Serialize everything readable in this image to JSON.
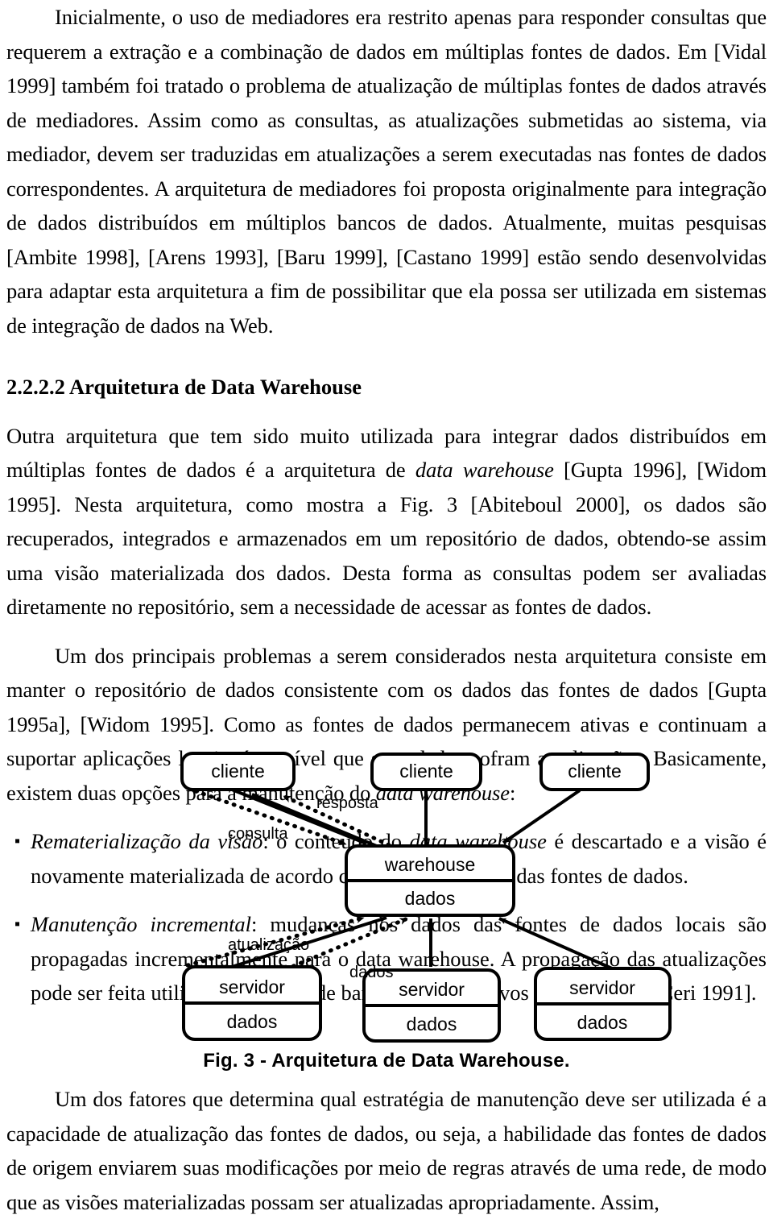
{
  "document": {
    "paragraphs": [
      {
        "id": "p1",
        "indent": true,
        "text": "Inicialmente, o uso de mediadores era restrito apenas para responder consultas que requerem a extração e a combinação de dados em múltiplas fontes de dados. Em [Vidal 1999] também foi tratado o problema de atualização de múltiplas fontes de dados através de mediadores. Assim como as consultas, as atualizações submetidas ao sistema, via mediador, devem ser traduzidas em atualizações a serem executadas nas fontes de dados correspondentes. A arquitetura de mediadores foi proposta originalmente para integração de dados distribuídos em múltiplos bancos de dados. Atualmente, muitas pesquisas [Ambite 1998], [Arens 1993], [Baru 1999], [Castano 1999] estão sendo desenvolvidas para adaptar esta arquitetura a fim de possibilitar que ela possa ser utilizada em sistemas de integração de dados na Web."
      }
    ],
    "heading": "2.2.2.2 Arquitetura de Data Warehouse",
    "paragraph2_parts": {
      "a": "Outra arquitetura que tem sido muito utilizada para integrar dados distribuídos em múltiplas fontes de dados é a arquitetura de ",
      "b_italic": "data warehouse",
      "c": " [Gupta 1996], [Widom 1995]. Nesta arquitetura, como mostra a Fig. 3 [Abiteboul 2000], os dados são recuperados, integrados e armazenados em um repositório de dados, obtendo-se assim uma visão materializada dos dados. Desta forma as consultas podem ser avaliadas diretamente no repositório, sem a necessidade de acessar as fontes de dados."
    },
    "paragraph3_parts": {
      "a": "Um dos principais problemas a serem considerados nesta arquitetura consiste em manter o repositório de dados consistente com os dados das fontes de dados [Gupta 1995a], [Widom 1995]. Como as fontes de dados permanecem ativas e continuam a suportar aplicações locais, é possível que seus dados sofram atualizações. Basicamente, existem duas opções para a manutenção do ",
      "b_italic": "data warehouse",
      "c": ":"
    },
    "bullets": [
      {
        "marker": "▪",
        "title_italic": "Rematerialização da visão",
        "mid": ": o conteúdo do ",
        "term_italic": "data warehouse",
        "rest": " é descartado e a visão é novamente materializada de acordo com os novos dados das fontes de dados."
      },
      {
        "marker": "▪",
        "title_italic": "Manutenção incremental",
        "mid": ": mudanças nos dados das fontes de dados locais são propagadas incrementalmente para o data warehouse. A propagação das atualizações pode ser feita utilizando técnicas de banco de dados ativos [Zhou 1996], [Ceri 1991].",
        "term_italic": "",
        "rest": ""
      }
    ],
    "paragraph4": "Um dos fatores que determina qual estratégia de manutenção deve ser utilizada é a capacidade de atualização das fontes de dados, ou seja, a habilidade das fontes de dados de origem enviarem suas modificações por meio de regras através de uma rede, de modo que as visões materializadas possam ser atualizadas apropriadamente. Assim,"
  },
  "figure": {
    "caption": "Fig. 3 - Arquitetura de Data Warehouse.",
    "nodes": {
      "client1": "cliente",
      "client2": "cliente",
      "client3": "cliente",
      "warehouse_top": "warehouse",
      "warehouse_bottom": "dados",
      "server1_top": "servidor",
      "server1_bottom": "dados",
      "server2_top": "servidor",
      "server2_bottom": "dados",
      "server3_top": "servidor",
      "server3_bottom": "dados"
    },
    "edge_labels": {
      "resposta": "resposta",
      "consulta": "consulta",
      "atualizacao": "atualização",
      "dados": "dados"
    },
    "colors": {
      "stroke": "#000000",
      "fill": "#ffffff"
    }
  }
}
